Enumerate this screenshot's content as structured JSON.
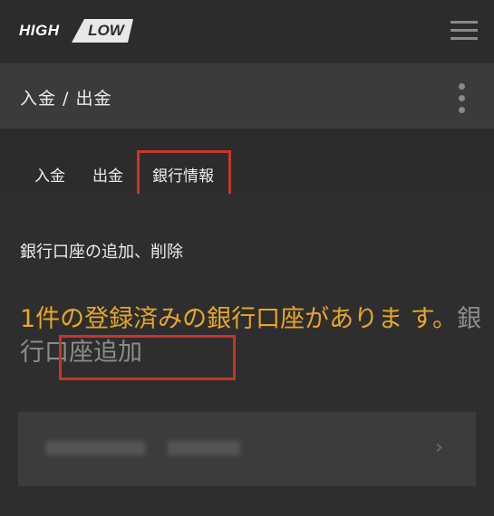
{
  "brand": {
    "logo_left": "HIGH",
    "logo_right": "LOW"
  },
  "header": {
    "breadcrumb": "入金 / 出金"
  },
  "tabs": [
    {
      "label": "入金"
    },
    {
      "label": "出金"
    },
    {
      "label": "銀行情報",
      "selected": true
    }
  ],
  "main": {
    "section_title": "銀行口座の追加、削除",
    "notice_text": "1件の登録済みの銀行口座がありま す。",
    "add_link": "銀行口座追加"
  },
  "colors": {
    "accent": "#e6a72a",
    "highlight": "#c9342c",
    "background": "#2e2e2e"
  },
  "icons": {
    "menu": "hamburger-icon",
    "more": "kebab-icon",
    "chevron": "chevron-right-icon"
  }
}
